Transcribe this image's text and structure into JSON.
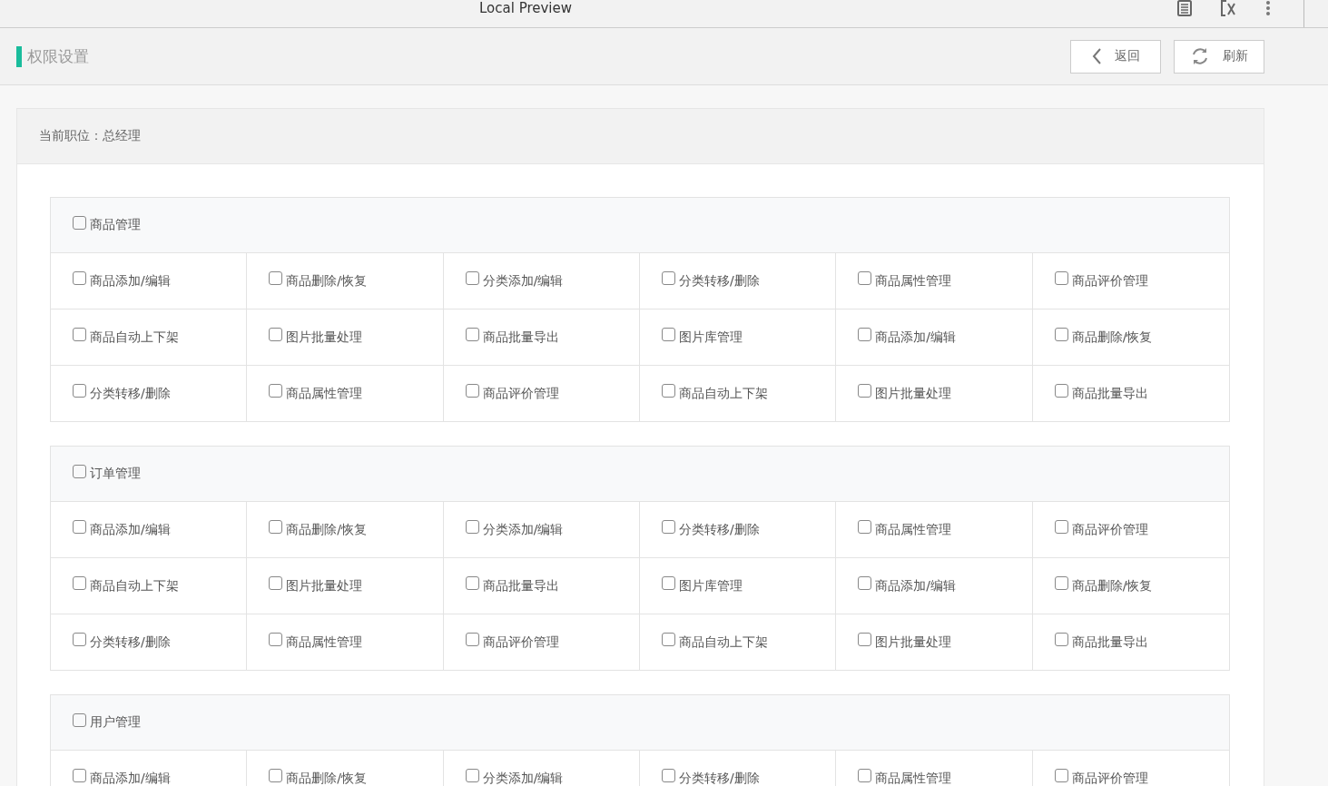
{
  "window": {
    "title": "Local Preview"
  },
  "page": {
    "title": "权限设置",
    "buttons": [
      {
        "kind": "back",
        "label": "返回"
      },
      {
        "kind": "refresh",
        "label": "刷新"
      }
    ]
  },
  "position": {
    "label": "当前职位：",
    "value": "总经理"
  },
  "sections": [
    {
      "title": "商品管理",
      "checked": false,
      "items": [
        {
          "label": "商品添加/编辑",
          "checked": false
        },
        {
          "label": "商品删除/恢复",
          "checked": false
        },
        {
          "label": "分类添加/编辑",
          "checked": false
        },
        {
          "label": "分类转移/删除",
          "checked": false
        },
        {
          "label": "商品属性管理",
          "checked": false
        },
        {
          "label": "商品评价管理",
          "checked": false
        },
        {
          "label": "商品自动上下架",
          "checked": false
        },
        {
          "label": "图片批量处理",
          "checked": false
        },
        {
          "label": "商品批量导出",
          "checked": false
        },
        {
          "label": "图片库管理",
          "checked": false
        },
        {
          "label": "商品添加/编辑",
          "checked": false
        },
        {
          "label": "商品删除/恢复",
          "checked": false
        },
        {
          "label": "分类转移/删除",
          "checked": false
        },
        {
          "label": "商品属性管理",
          "checked": false
        },
        {
          "label": "商品评价管理",
          "checked": false
        },
        {
          "label": "商品自动上下架",
          "checked": false
        },
        {
          "label": "图片批量处理",
          "checked": false
        },
        {
          "label": "商品批量导出",
          "checked": false
        }
      ]
    },
    {
      "title": "订单管理",
      "checked": false,
      "items": [
        {
          "label": "商品添加/编辑",
          "checked": false
        },
        {
          "label": "商品删除/恢复",
          "checked": false
        },
        {
          "label": "分类添加/编辑",
          "checked": false
        },
        {
          "label": "分类转移/删除",
          "checked": false
        },
        {
          "label": "商品属性管理",
          "checked": false
        },
        {
          "label": "商品评价管理",
          "checked": false
        },
        {
          "label": "商品自动上下架",
          "checked": false
        },
        {
          "label": "图片批量处理",
          "checked": false
        },
        {
          "label": "商品批量导出",
          "checked": false
        },
        {
          "label": "图片库管理",
          "checked": false
        },
        {
          "label": "商品添加/编辑",
          "checked": false
        },
        {
          "label": "商品删除/恢复",
          "checked": false
        },
        {
          "label": "分类转移/删除",
          "checked": false
        },
        {
          "label": "商品属性管理",
          "checked": false
        },
        {
          "label": "商品评价管理",
          "checked": false
        },
        {
          "label": "商品自动上下架",
          "checked": false
        },
        {
          "label": "图片批量处理",
          "checked": false
        },
        {
          "label": "商品批量导出",
          "checked": false
        }
      ]
    },
    {
      "title": "用户管理",
      "checked": false,
      "items": [
        {
          "label": "商品添加/编辑",
          "checked": false
        },
        {
          "label": "商品删除/恢复",
          "checked": false
        },
        {
          "label": "分类添加/编辑",
          "checked": false
        },
        {
          "label": "分类转移/删除",
          "checked": false
        },
        {
          "label": "商品属性管理",
          "checked": false
        },
        {
          "label": "商品评价管理",
          "checked": false
        }
      ]
    }
  ]
}
